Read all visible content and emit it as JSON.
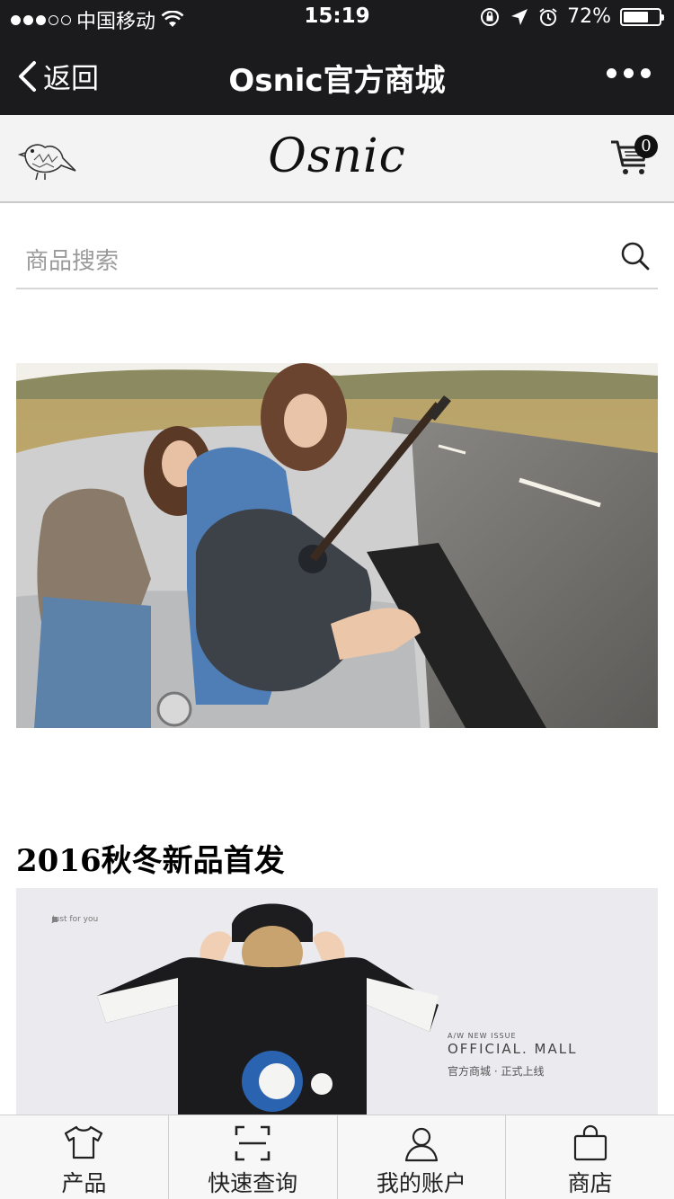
{
  "status_bar": {
    "carrier": "中国移动",
    "time": "15:19",
    "battery": "72%",
    "battery_level": 0.72
  },
  "nav": {
    "back_label": "返回",
    "title": "Osnic官方商城"
  },
  "store_header": {
    "brand": "Osnic",
    "cart_count": "0"
  },
  "search": {
    "placeholder": "商品搜索"
  },
  "section": {
    "title": "2016秋冬新品首发"
  },
  "promo": {
    "small_text": "Just for you",
    "new_issue": "A/W NEW ISSUE",
    "headline": "OFFICIAL. MALL",
    "subline": "官方商城 · 正式上线"
  },
  "tabs": [
    {
      "label": "产品",
      "icon": "tshirt-icon"
    },
    {
      "label": "快速查询",
      "icon": "scan-icon"
    },
    {
      "label": "我的账户",
      "icon": "user-icon"
    },
    {
      "label": "商店",
      "icon": "bag-icon"
    }
  ]
}
